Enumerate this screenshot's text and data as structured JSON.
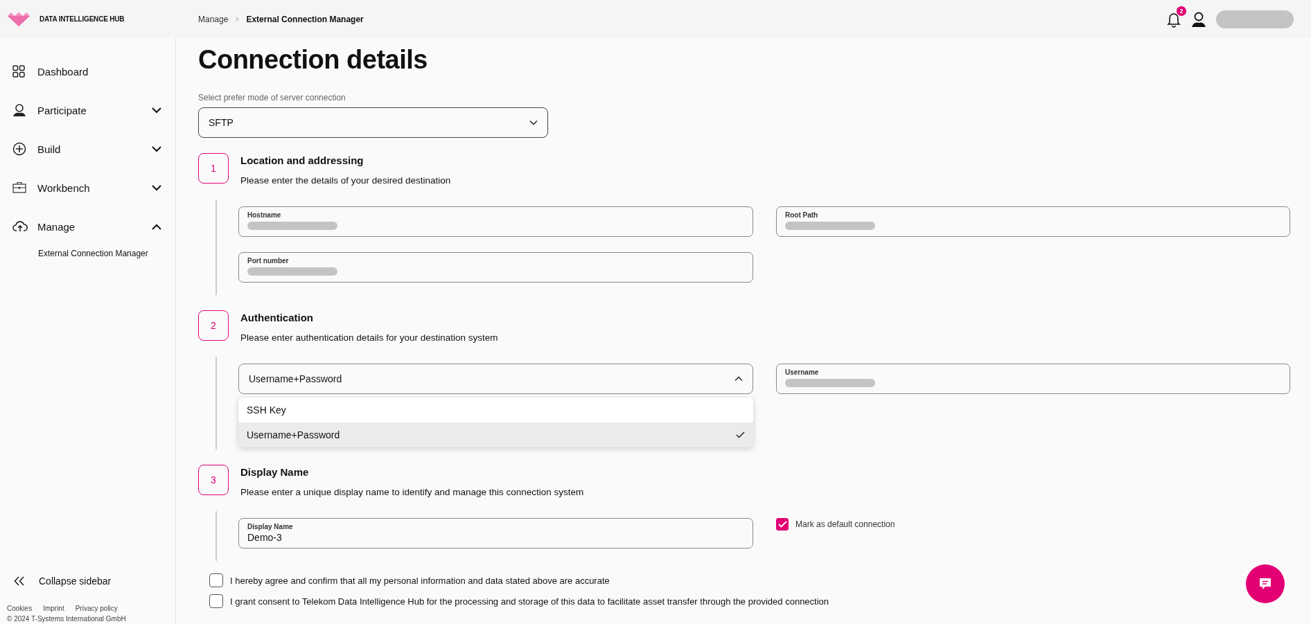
{
  "header": {
    "brand": "DATA INTELLIGENCE HUB",
    "breadcrumb": [
      "Manage",
      "External Connection Manager"
    ],
    "notifications": "2"
  },
  "sidebar": {
    "items": [
      {
        "label": "Dashboard"
      },
      {
        "label": "Participate",
        "expanded": false
      },
      {
        "label": "Build",
        "expanded": false
      },
      {
        "label": "Workbench",
        "expanded": false
      },
      {
        "label": "Manage",
        "expanded": true,
        "children": [
          {
            "label": "External Connection Manager"
          }
        ]
      }
    ],
    "collapse": "Collapse sidebar",
    "footer_links": [
      "Cookies",
      "Imprint",
      "Privacy policy"
    ],
    "copyright": "© 2024 T-Systems International GmbH"
  },
  "page": {
    "title": "Connection details",
    "mode_label": "Select prefer mode of server connection",
    "mode_value": "SFTP",
    "steps": [
      {
        "number": "1",
        "title": "Location and addressing",
        "description": "Please enter the details of your desired destination",
        "fields": [
          {
            "kind": "text",
            "label": "Hostname"
          },
          {
            "kind": "text",
            "label": "Root Path"
          },
          {
            "kind": "text",
            "label": "Port number"
          }
        ]
      },
      {
        "number": "2",
        "title": "Authentication",
        "description": "Please enter authentication details for your destination system",
        "fields": [
          {
            "kind": "select",
            "value": "Username+Password",
            "expanded": true,
            "options": [
              {
                "label": "SSH Key",
                "selected": false
              },
              {
                "label": "Username+Password",
                "selected": true
              }
            ]
          },
          {
            "kind": "text",
            "label": "Username"
          }
        ]
      },
      {
        "number": "3",
        "title": "Display Name",
        "description": "Please enter a unique display name to identify and manage this connection system",
        "fields": [
          {
            "kind": "text",
            "label": "Display Name",
            "value": "Demo-3"
          },
          {
            "kind": "checkbox",
            "label": "Mark as default connection",
            "checked": true
          }
        ]
      }
    ],
    "consents": [
      {
        "label": "I hereby agree and confirm that all my personal information and data stated above are accurate",
        "checked": false
      },
      {
        "label": "I grant consent to Telekom Data Intelligence Hub for the processing and storage of this data to facilitate asset transfer through the provided connection",
        "checked": false
      }
    ]
  }
}
